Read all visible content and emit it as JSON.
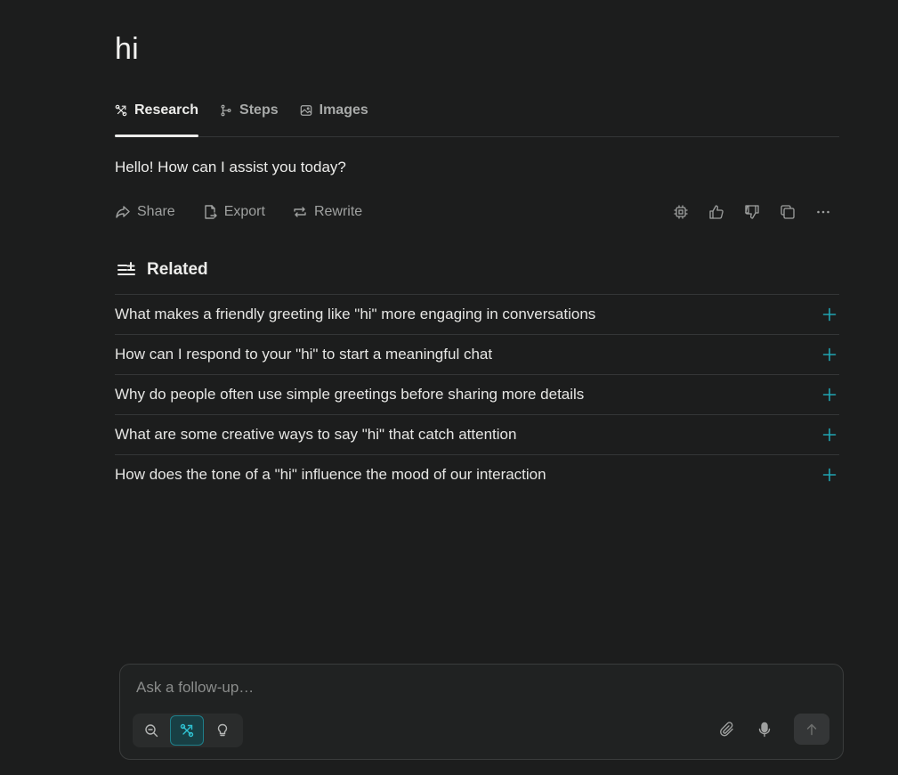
{
  "query": {
    "title": "hi"
  },
  "tabs": [
    {
      "label": "Research",
      "icon": "research-icon",
      "active": true
    },
    {
      "label": "Steps",
      "icon": "steps-icon",
      "active": false
    },
    {
      "label": "Images",
      "icon": "image-icon",
      "active": false
    }
  ],
  "answer": {
    "text": "Hello! How can I assist you today?"
  },
  "actions": {
    "share_label": "Share",
    "export_label": "Export",
    "rewrite_label": "Rewrite",
    "right_icons": [
      "chip-icon",
      "thumbs-up-icon",
      "thumbs-down-icon",
      "copy-icon",
      "more-icon"
    ]
  },
  "related": {
    "heading": "Related",
    "items": [
      "What makes a friendly greeting like \"hi\" more engaging in conversations",
      "How can I respond to your \"hi\" to start a meaningful chat",
      "Why do people often use simple greetings before sharing more details",
      "What are some creative ways to say \"hi\" that catch attention",
      "How does the tone of a \"hi\" influence the mood of our interaction"
    ]
  },
  "composer": {
    "placeholder": "Ask a follow-up…",
    "value": "",
    "modes": [
      "search-icon",
      "research-icon",
      "lightbulb-icon"
    ],
    "active_mode": "research-icon"
  },
  "colors": {
    "background": "#1c1d1d",
    "accent": "#20a4b2",
    "text": "#ececea",
    "muted": "#9fa1a0"
  }
}
